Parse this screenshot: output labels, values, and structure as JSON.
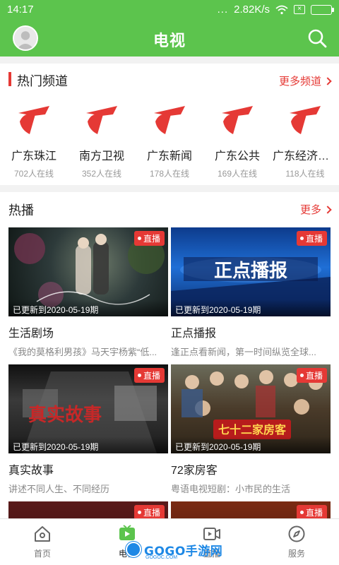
{
  "status_bar": {
    "time": "14:17",
    "signal_dots": "...",
    "speed": "2.82K/s"
  },
  "header": {
    "title": "电视"
  },
  "channels": {
    "title": "热门频道",
    "more_label": "更多频道",
    "items": [
      {
        "name": "广东珠江",
        "online": "702人在线"
      },
      {
        "name": "南方卫视",
        "online": "352人在线"
      },
      {
        "name": "广东新闻",
        "online": "178人在线"
      },
      {
        "name": "广东公共",
        "online": "169人在线"
      },
      {
        "name": "广东经济科...",
        "online": "118人在线"
      }
    ]
  },
  "hot": {
    "title": "热播",
    "more_label": "更多",
    "live_label": "直播",
    "items": [
      {
        "title": "生活剧场",
        "desc": "《我的莫格利男孩》马天宇杨紫“低...",
        "updated": "已更新到2020-05-19期"
      },
      {
        "title": "正点播报",
        "desc": "逢正点看新闻，第一时间纵览全球...",
        "updated": "已更新到2020-05-19期",
        "overlay": "正点播报"
      },
      {
        "title": "真实故事",
        "desc": "讲述不同人生、不同经历",
        "updated": "已更新到2020-05-19期",
        "overlay": "真实故事"
      },
      {
        "title": "72家房客",
        "desc": "粤语电视短剧：小市民的生活",
        "updated": "已更新到2020-05-19期",
        "overlay": "七十二家房客"
      },
      {
        "title": "",
        "desc": "",
        "updated": ""
      },
      {
        "title": "",
        "desc": "",
        "updated": ""
      }
    ]
  },
  "bottom_nav": {
    "items": [
      {
        "label": "首页"
      },
      {
        "label": "电视"
      },
      {
        "label": "直播"
      },
      {
        "label": "服务"
      }
    ]
  },
  "watermark": {
    "text": "GOGO手游网",
    "sub": "GOGOC.COM"
  },
  "colors": {
    "primary_green": "#5cc44d",
    "accent_red": "#e53935",
    "watermark_blue": "#1e88e5"
  }
}
